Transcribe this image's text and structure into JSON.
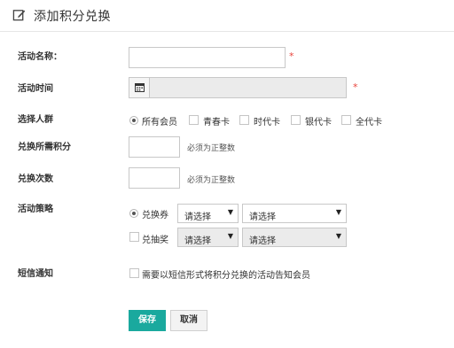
{
  "header": {
    "title": "添加积分兑换",
    "icon": "edit-icon"
  },
  "form": {
    "name": {
      "label": "活动名称：",
      "value": "",
      "required_mark": "*"
    },
    "time": {
      "label": "活动时间",
      "value": "",
      "required_mark": "*",
      "icon": "calendar-icon"
    },
    "audience": {
      "label": "选择人群",
      "options": [
        {
          "label": "所有会员",
          "checked": true
        },
        {
          "label": "青春卡",
          "checked": false
        },
        {
          "label": "时代卡",
          "checked": false
        },
        {
          "label": "银代卡",
          "checked": false
        },
        {
          "label": "全代卡",
          "checked": false
        }
      ]
    },
    "points": {
      "label": "兑换所需积分",
      "value": "",
      "hint": "必须为正整数"
    },
    "times": {
      "label": "兑换次数",
      "value": "",
      "hint": "必须为正整数"
    },
    "strategy": {
      "label": "活动策略",
      "coupon": {
        "label": "兑换券",
        "checked": true,
        "select1": "请选择",
        "select2": "请选择"
      },
      "lottery": {
        "label": "兑抽奖",
        "checked": false,
        "select1": "请选择",
        "select2": "请选择"
      }
    },
    "sms": {
      "label": "短信通知",
      "option": "需要以短信形式将积分兑换的活动告知会员",
      "checked": false
    }
  },
  "actions": {
    "save": "保存",
    "cancel": "取消"
  },
  "colors": {
    "primary": "#1aa99e",
    "required": "#e8433b"
  }
}
